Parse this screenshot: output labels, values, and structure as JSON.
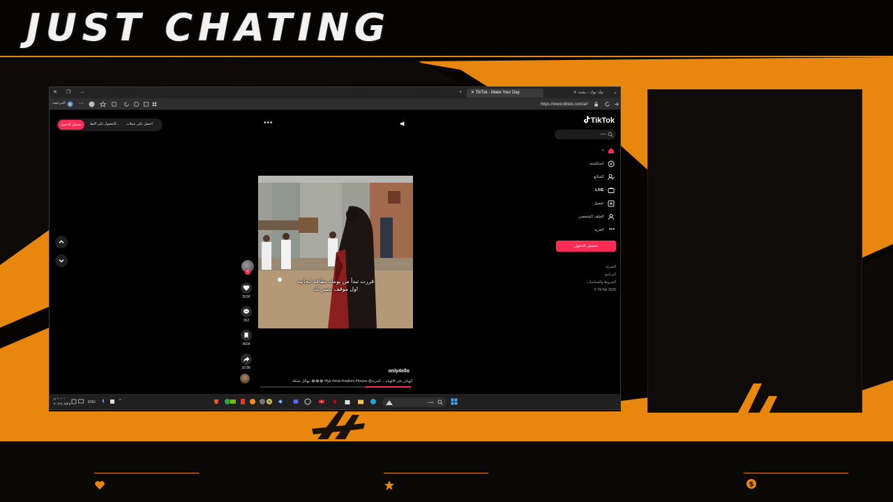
{
  "overlay": {
    "title": "JUST CHATING",
    "accent_color": "#e8870d",
    "footer_icons": [
      "heart-icon",
      "star-icon",
      "dollar-coin-icon"
    ]
  },
  "browser": {
    "tabs": [
      {
        "label": "تيك توك - بحث",
        "active": false
      },
      {
        "label": "TikTok - Make Your Day",
        "active": true
      }
    ],
    "url": "https://www.tiktok.com/ar/",
    "bookmarks_label": "المرخصة"
  },
  "tiktok": {
    "logo": "TikTok",
    "search_placeholder": "بحث",
    "top_pill": {
      "get_coins": "احصل على عملات",
      "get_app": "الحصول على التط...",
      "login": "تسجيل الدخول"
    },
    "sidebar": [
      {
        "label": "",
        "icon": "home-icon",
        "active": true
      },
      {
        "label": "استكشف",
        "icon": "compass-icon"
      },
      {
        "label": "المتابَع",
        "icon": "following-icon"
      },
      {
        "label": "LIVE",
        "icon": "live-icon"
      },
      {
        "label": "تحميل",
        "icon": "upload-icon"
      },
      {
        "label": "الملف الشخصي",
        "icon": "profile-icon"
      },
      {
        "label": "المزيد",
        "icon": "more-icon"
      }
    ],
    "login_button": "تسجيل الدخول",
    "footer_links": [
      "الشركة",
      "البرنامج",
      "الشروط والسياسات",
      "© TikTok 2026"
    ],
    "video": {
      "caption_line1": "قررت تبدأ من يومك بطاقة ايجابيه",
      "caption_line2": "اول موقف بصير لك",
      "username": "only4ello",
      "description": "بتهالل بتحكك 😂😂😂 #fyp #viral #explore #foryou @الهيام_على #الهيام ... المزيد",
      "progress": 0.3
    },
    "actions": {
      "likes": "363K",
      "comments": "352",
      "saves": "4504",
      "shares": "20.8K"
    }
  },
  "taskbar": {
    "search_label": "بحث",
    "language": "ENG",
    "time": "١٠:٠٠ م",
    "date": "٢٠٢٦/٠٧/٢٥"
  }
}
